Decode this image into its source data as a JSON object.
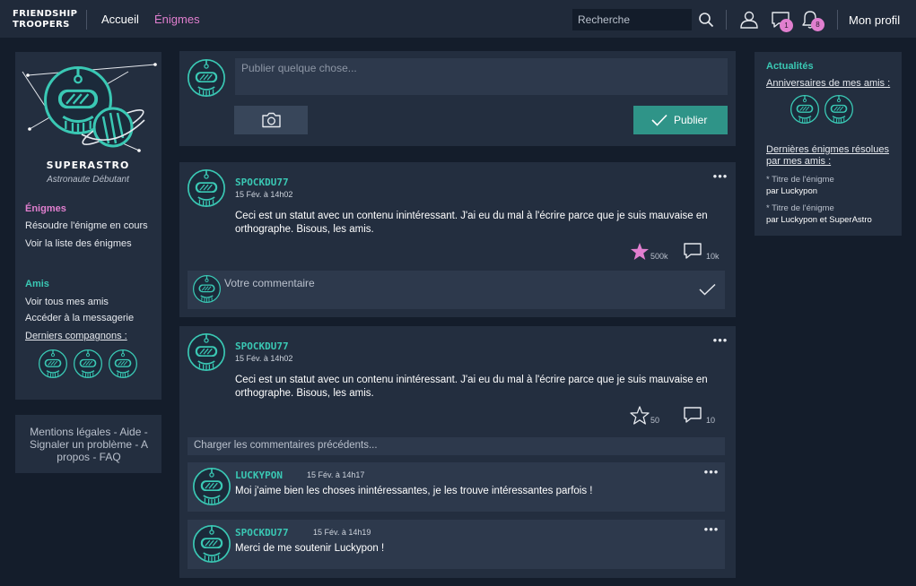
{
  "nav": {
    "logo_line1": "FRIENDSHIP",
    "logo_line2": "TROOPERS",
    "links": [
      "Accueil",
      "Énigmes"
    ],
    "search_placeholder": "Recherche",
    "messages_badge": "1",
    "notifications_badge": "8",
    "profile_label": "Mon profil"
  },
  "colors": {
    "background": "#141d2b",
    "panel": "#232e3f",
    "accent_teal": "#3ac8b4",
    "accent_pink": "#e17fcf",
    "button_teal": "#2f9488"
  },
  "left_sidebar": {
    "username": "SUPERASTRO",
    "rank": "Astronaute Débutant",
    "enigmes_title": "Énigmes",
    "enigmes_links": [
      "Résoudre l'énigme en cours",
      "Voir la liste des énigmes"
    ],
    "amis_title": "Amis",
    "amis_links": [
      "Voir tous mes amis",
      "Accéder à la messagerie"
    ],
    "companions_label": "Derniers compagnons :"
  },
  "footer": {
    "links": [
      "Mentions légales",
      "Aide",
      "Signaler un problème",
      "A propos",
      "FAQ"
    ]
  },
  "composer": {
    "placeholder": "Publier quelque chose...",
    "publish_label": "Publier"
  },
  "posts": [
    {
      "author": "SPOCKDU77",
      "date": "15 Fév. à 14h02",
      "text": "Ceci est un statut avec un contenu inintéressant. J'ai eu du mal à l'écrire parce que je suis mauvaise en orthographe. Bisous, les amis.",
      "likes": "500k",
      "liked": true,
      "comments_count": "10k",
      "comment_placeholder": "Votre commentaire"
    },
    {
      "author": "SPOCKDU77",
      "date": "15 Fév. à 14h02",
      "text": "Ceci est un statut avec un contenu inintéressant. J'ai eu du mal à l'écrire parce que je suis mauvaise en orthographe. Bisous, les amis.",
      "likes": "50",
      "liked": false,
      "comments_count": "10",
      "load_more": "Charger les commentaires précédents...",
      "comments": [
        {
          "author": "LUCKYPON",
          "date": "15 Fév. à 14h17",
          "text": "Moi j'aime bien les choses inintéressantes, je les trouve intéressantes parfois !"
        },
        {
          "author": "SPOCKDU77",
          "date": "15 Fév. à 14h19",
          "text": "Merci de me soutenir Luckypon !"
        }
      ]
    }
  ],
  "right_sidebar": {
    "title": "Actualités",
    "birthdays_label": "Anniversaires de mes amis :",
    "solved_label_line1": "Dernières énigmes résolues",
    "solved_label_line2": "par mes amis :",
    "solved": [
      {
        "title": "* Titre de l'énigme",
        "by": "par Luckypon"
      },
      {
        "title": "* Titre de l'énigme",
        "by": "par Luckypon et SuperAstro"
      }
    ]
  },
  "icons": [
    "search-icon",
    "user-icon",
    "chat-icon",
    "bell-icon",
    "camera-icon",
    "check-icon",
    "star-icon",
    "comment-icon",
    "more-icon",
    "astronaut-avatar-icon"
  ]
}
